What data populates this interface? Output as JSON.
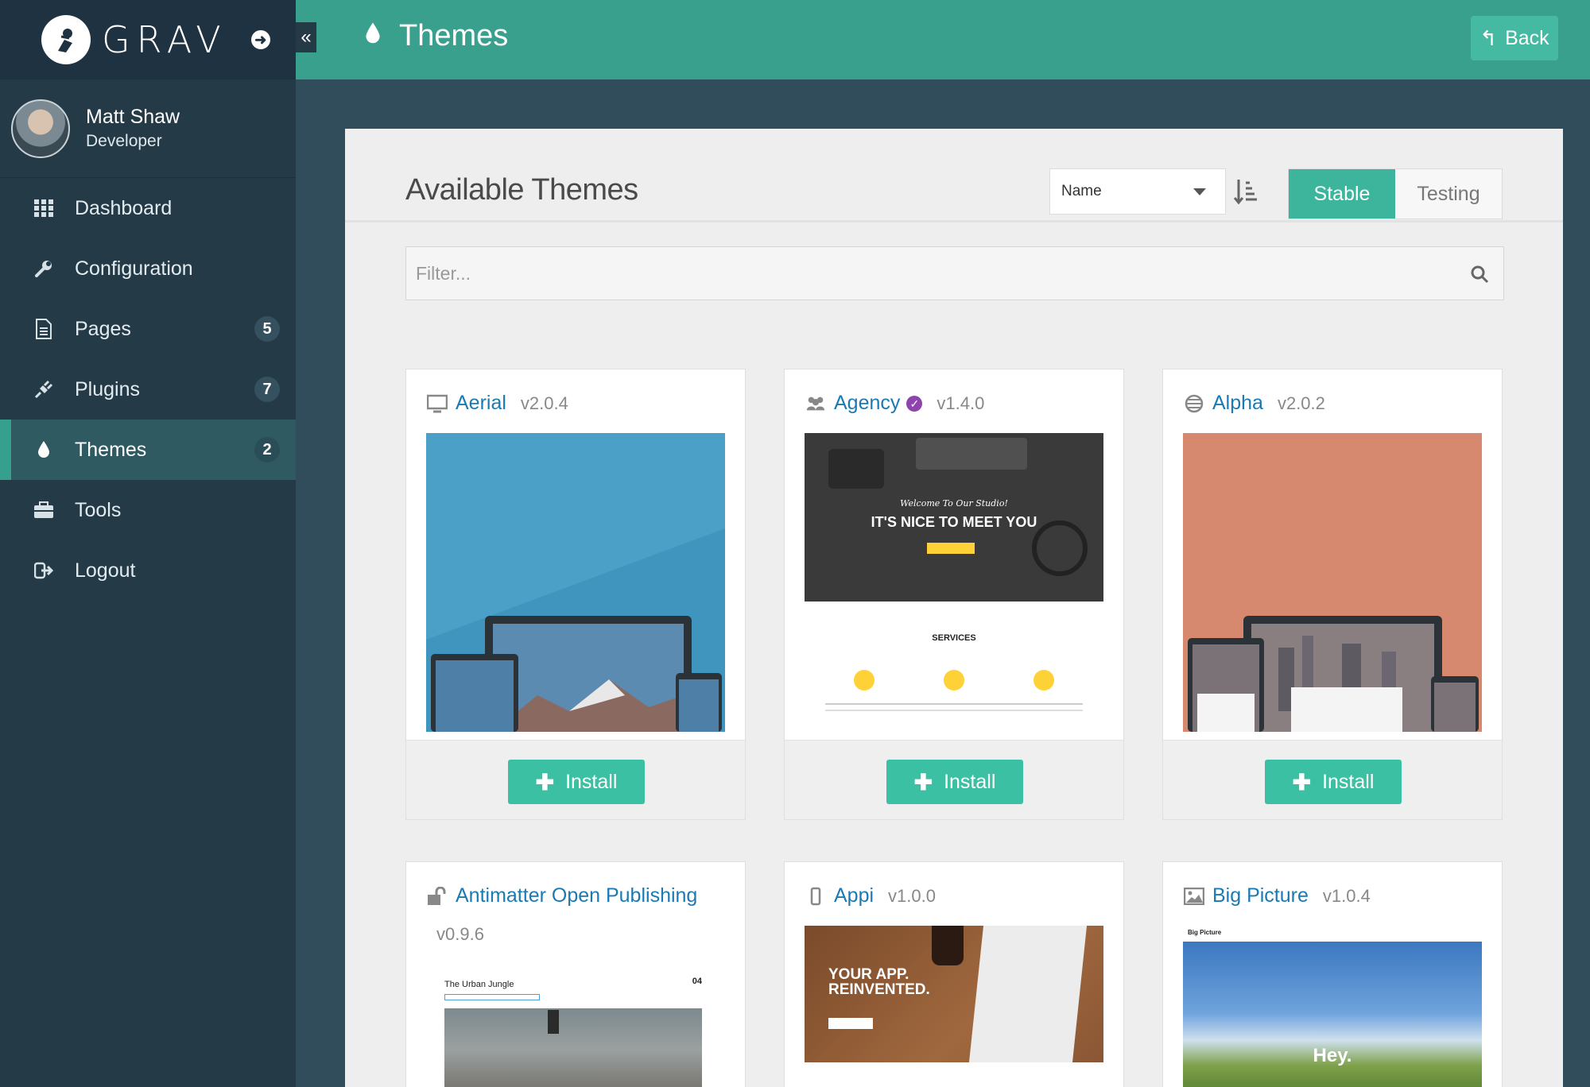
{
  "app": {
    "logo_text": "GRAV"
  },
  "user": {
    "name": "Matt Shaw",
    "role": "Developer"
  },
  "nav": [
    {
      "label": "Dashboard",
      "icon": "grid-icon"
    },
    {
      "label": "Configuration",
      "icon": "wrench-icon"
    },
    {
      "label": "Pages",
      "icon": "page-icon",
      "badge": "5"
    },
    {
      "label": "Plugins",
      "icon": "plug-icon",
      "badge": "7"
    },
    {
      "label": "Themes",
      "icon": "drop-icon",
      "badge": "2",
      "active": true
    },
    {
      "label": "Tools",
      "icon": "briefcase-icon"
    },
    {
      "label": "Logout",
      "icon": "logout-icon"
    }
  ],
  "topbar": {
    "title": "Themes",
    "back_label": "Back"
  },
  "panel": {
    "title": "Available Themes",
    "sort_value": "Name",
    "toggle": {
      "stable": "Stable",
      "testing": "Testing",
      "selected": "Stable"
    },
    "filter_placeholder": "Filter..."
  },
  "themes": [
    {
      "name": "Aerial",
      "version": "v2.0.4",
      "icon": "monitor-icon",
      "install_label": "Install"
    },
    {
      "name": "Agency",
      "version": "v1.4.0",
      "icon": "users-icon",
      "verified": true,
      "install_label": "Install",
      "preview": {
        "welcome": "Welcome To Our Studio!",
        "headline": "IT'S NICE TO MEET YOU",
        "section": "SERVICES"
      }
    },
    {
      "name": "Alpha",
      "version": "v2.0.2",
      "icon": "globe-icon",
      "install_label": "Install"
    },
    {
      "name": "Antimatter Open Publishing",
      "version": "v0.9.6",
      "icon": "unlock-icon",
      "preview": {
        "post_title": "The Urban Jungle",
        "date": "04"
      }
    },
    {
      "name": "Appi",
      "version": "v1.0.0",
      "icon": "mobile-icon",
      "preview": {
        "headline": "YOUR APP. REINVENTED."
      }
    },
    {
      "name": "Big Picture",
      "version": "v1.0.4",
      "icon": "image-icon",
      "preview": {
        "brand": "Big Picture",
        "hero": "Hey."
      }
    }
  ],
  "colors": {
    "accent": "#3aa08e",
    "button": "#3cc0a3",
    "sidebar": "#253a47",
    "link": "#1a7ab3"
  }
}
